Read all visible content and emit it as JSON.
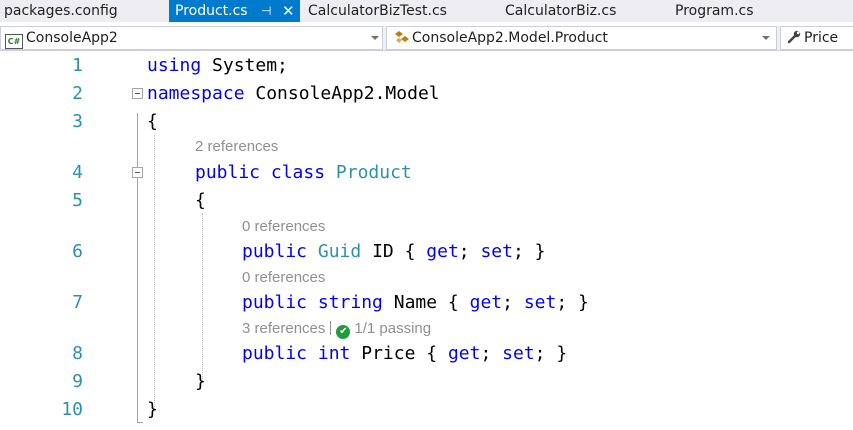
{
  "tabs": [
    {
      "label": "packages.config",
      "active": false
    },
    {
      "label": "Product.cs",
      "active": true
    },
    {
      "label": "CalculatorBizTest.cs",
      "active": false
    },
    {
      "label": "CalculatorBiz.cs",
      "active": false
    },
    {
      "label": "Program.cs",
      "active": false
    }
  ],
  "tab_icons": {
    "pin": "pin-icon",
    "close": "close-icon"
  },
  "navbar": {
    "project": {
      "label": "ConsoleApp2",
      "icon": "csharp-project-icon",
      "icon_text": "C#"
    },
    "type": {
      "label": "ConsoleApp2.Model.Product",
      "icon": "class-icon"
    },
    "member": {
      "label": "Price",
      "icon": "wrench-icon"
    }
  },
  "code": {
    "lines": [
      {
        "number": "1",
        "tokens": [
          {
            "t": "using",
            "c": "kw"
          },
          {
            "t": " System;",
            "c": ""
          }
        ]
      },
      {
        "number": "2",
        "tokens": [
          {
            "t": "namespace",
            "c": "kw"
          },
          {
            "t": " ConsoleApp2.Model",
            "c": ""
          }
        ]
      },
      {
        "number": "3",
        "tokens": [
          {
            "t": "{",
            "c": ""
          }
        ]
      },
      {
        "number": "4",
        "tokens": [
          {
            "t": "public",
            "c": "kw"
          },
          {
            "t": " ",
            "c": ""
          },
          {
            "t": "class",
            "c": "kw"
          },
          {
            "t": " ",
            "c": ""
          },
          {
            "t": "Product",
            "c": "ty"
          }
        ]
      },
      {
        "number": "5",
        "tokens": [
          {
            "t": "{",
            "c": ""
          }
        ]
      },
      {
        "number": "6",
        "tokens": [
          {
            "t": "public",
            "c": "kw"
          },
          {
            "t": " ",
            "c": ""
          },
          {
            "t": "Guid",
            "c": "ty"
          },
          {
            "t": " ID { ",
            "c": ""
          },
          {
            "t": "get",
            "c": "kw"
          },
          {
            "t": "; ",
            "c": ""
          },
          {
            "t": "set",
            "c": "kw"
          },
          {
            "t": "; }",
            "c": ""
          }
        ]
      },
      {
        "number": "7",
        "tokens": [
          {
            "t": "public",
            "c": "kw"
          },
          {
            "t": " ",
            "c": ""
          },
          {
            "t": "string",
            "c": "kw"
          },
          {
            "t": " Name { ",
            "c": ""
          },
          {
            "t": "get",
            "c": "kw"
          },
          {
            "t": "; ",
            "c": ""
          },
          {
            "t": "set",
            "c": "kw"
          },
          {
            "t": "; }",
            "c": ""
          }
        ]
      },
      {
        "number": "8",
        "tokens": [
          {
            "t": "public",
            "c": "kw"
          },
          {
            "t": " ",
            "c": ""
          },
          {
            "t": "int",
            "c": "kw"
          },
          {
            "t": " Price { ",
            "c": ""
          },
          {
            "t": "get",
            "c": "kw"
          },
          {
            "t": "; ",
            "c": ""
          },
          {
            "t": "set",
            "c": "kw"
          },
          {
            "t": "; }",
            "c": ""
          }
        ]
      },
      {
        "number": "9",
        "tokens": [
          {
            "t": "}",
            "c": ""
          }
        ]
      },
      {
        "number": "10",
        "tokens": [
          {
            "t": "}",
            "c": ""
          }
        ]
      }
    ],
    "codelens": [
      {
        "before_line": "4",
        "text": "2 references"
      },
      {
        "before_line": "6",
        "text": "0 references"
      },
      {
        "before_line": "7",
        "text": "0 references"
      },
      {
        "before_line": "8",
        "text": "3 references",
        "status_icon": "check-circle-icon",
        "status_text": "1/1 passing"
      }
    ]
  },
  "colors": {
    "keyword": "#0000ff",
    "type": "#2b91af",
    "line_number": "#2b91af",
    "accent_tab": "#007acc",
    "passing": "#1f9d3a"
  }
}
